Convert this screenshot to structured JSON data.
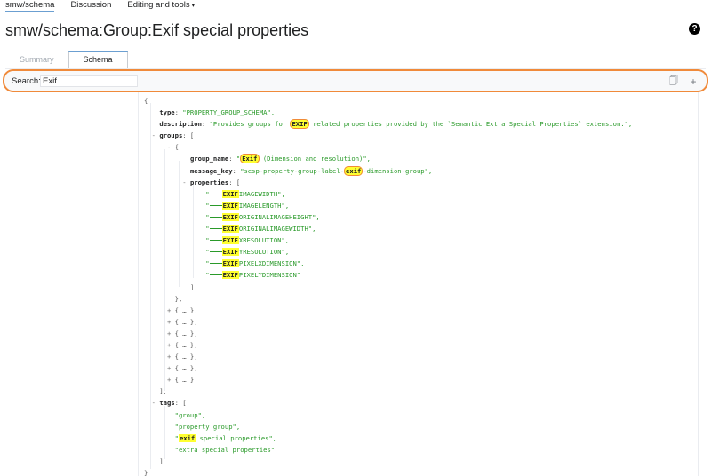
{
  "nav": {
    "tabs": [
      {
        "label": "smw/schema",
        "active": true
      },
      {
        "label": "Discussion",
        "active": false
      },
      {
        "label": "Editing and tools",
        "active": false,
        "dropdown": true
      }
    ],
    "caret": "▾"
  },
  "page": {
    "title": "smw/schema:Group:Exif special properties",
    "help_icon": "?"
  },
  "tabs": [
    {
      "label": "Summary",
      "active": false
    },
    {
      "label": "Schema",
      "active": true
    }
  ],
  "search": {
    "label": "Search:",
    "value": "Exif",
    "copy_icon": "🗍",
    "expand_icon": "+"
  },
  "colors": {
    "accent": "#f08a3a",
    "tab_indicator": "#6b9fd1",
    "highlight": "#ffff30",
    "string": "#2a9a2a"
  },
  "schema": {
    "type_key": "type",
    "type_value": "\"PROPERTY_GROUP_SCHEMA\",",
    "description_key": "description",
    "description_pre": "\"Provides groups for ",
    "description_match": "EXIF",
    "description_post": " related properties provided by the `Semantic Extra Special Properties` extension.\",",
    "groups_key": "groups",
    "group_name_key": "group_name",
    "group_name_pre": "\"",
    "group_name_match": "Exif",
    "group_name_post": " (Dimension and resolution)\",",
    "message_key_key": "message_key",
    "message_key_pre": "\"sesp-property-group-label-",
    "message_key_match": "exif",
    "message_key_post": "-dimension-group\",",
    "properties_key": "properties",
    "property_match": "EXIF",
    "properties": [
      "IMAGEWIDTH\",",
      "IMAGELENGTH\",",
      "ORIGINALIMAGEHEIGHT\",",
      "ORIGINALIMAGEWIDTH\",",
      "XRESOLUTION\",",
      "YRESOLUTION\",",
      "PIXELXDIMENSION\",",
      "PIXELYDIMENSION\""
    ],
    "collapsed_groups": [
      "{ … },",
      "{ … },",
      "{ … },",
      "{ … },",
      "{ … },",
      "{ … },",
      "{ … }"
    ],
    "tags_key": "tags",
    "tags": [
      {
        "pre": "\"group\",",
        "match": null,
        "post": ""
      },
      {
        "pre": "\"property group\",",
        "match": null,
        "post": ""
      },
      {
        "pre": "\"",
        "match": "exif",
        "post": " special properties\","
      },
      {
        "pre": "\"extra special properties\"",
        "match": null,
        "post": ""
      }
    ]
  }
}
